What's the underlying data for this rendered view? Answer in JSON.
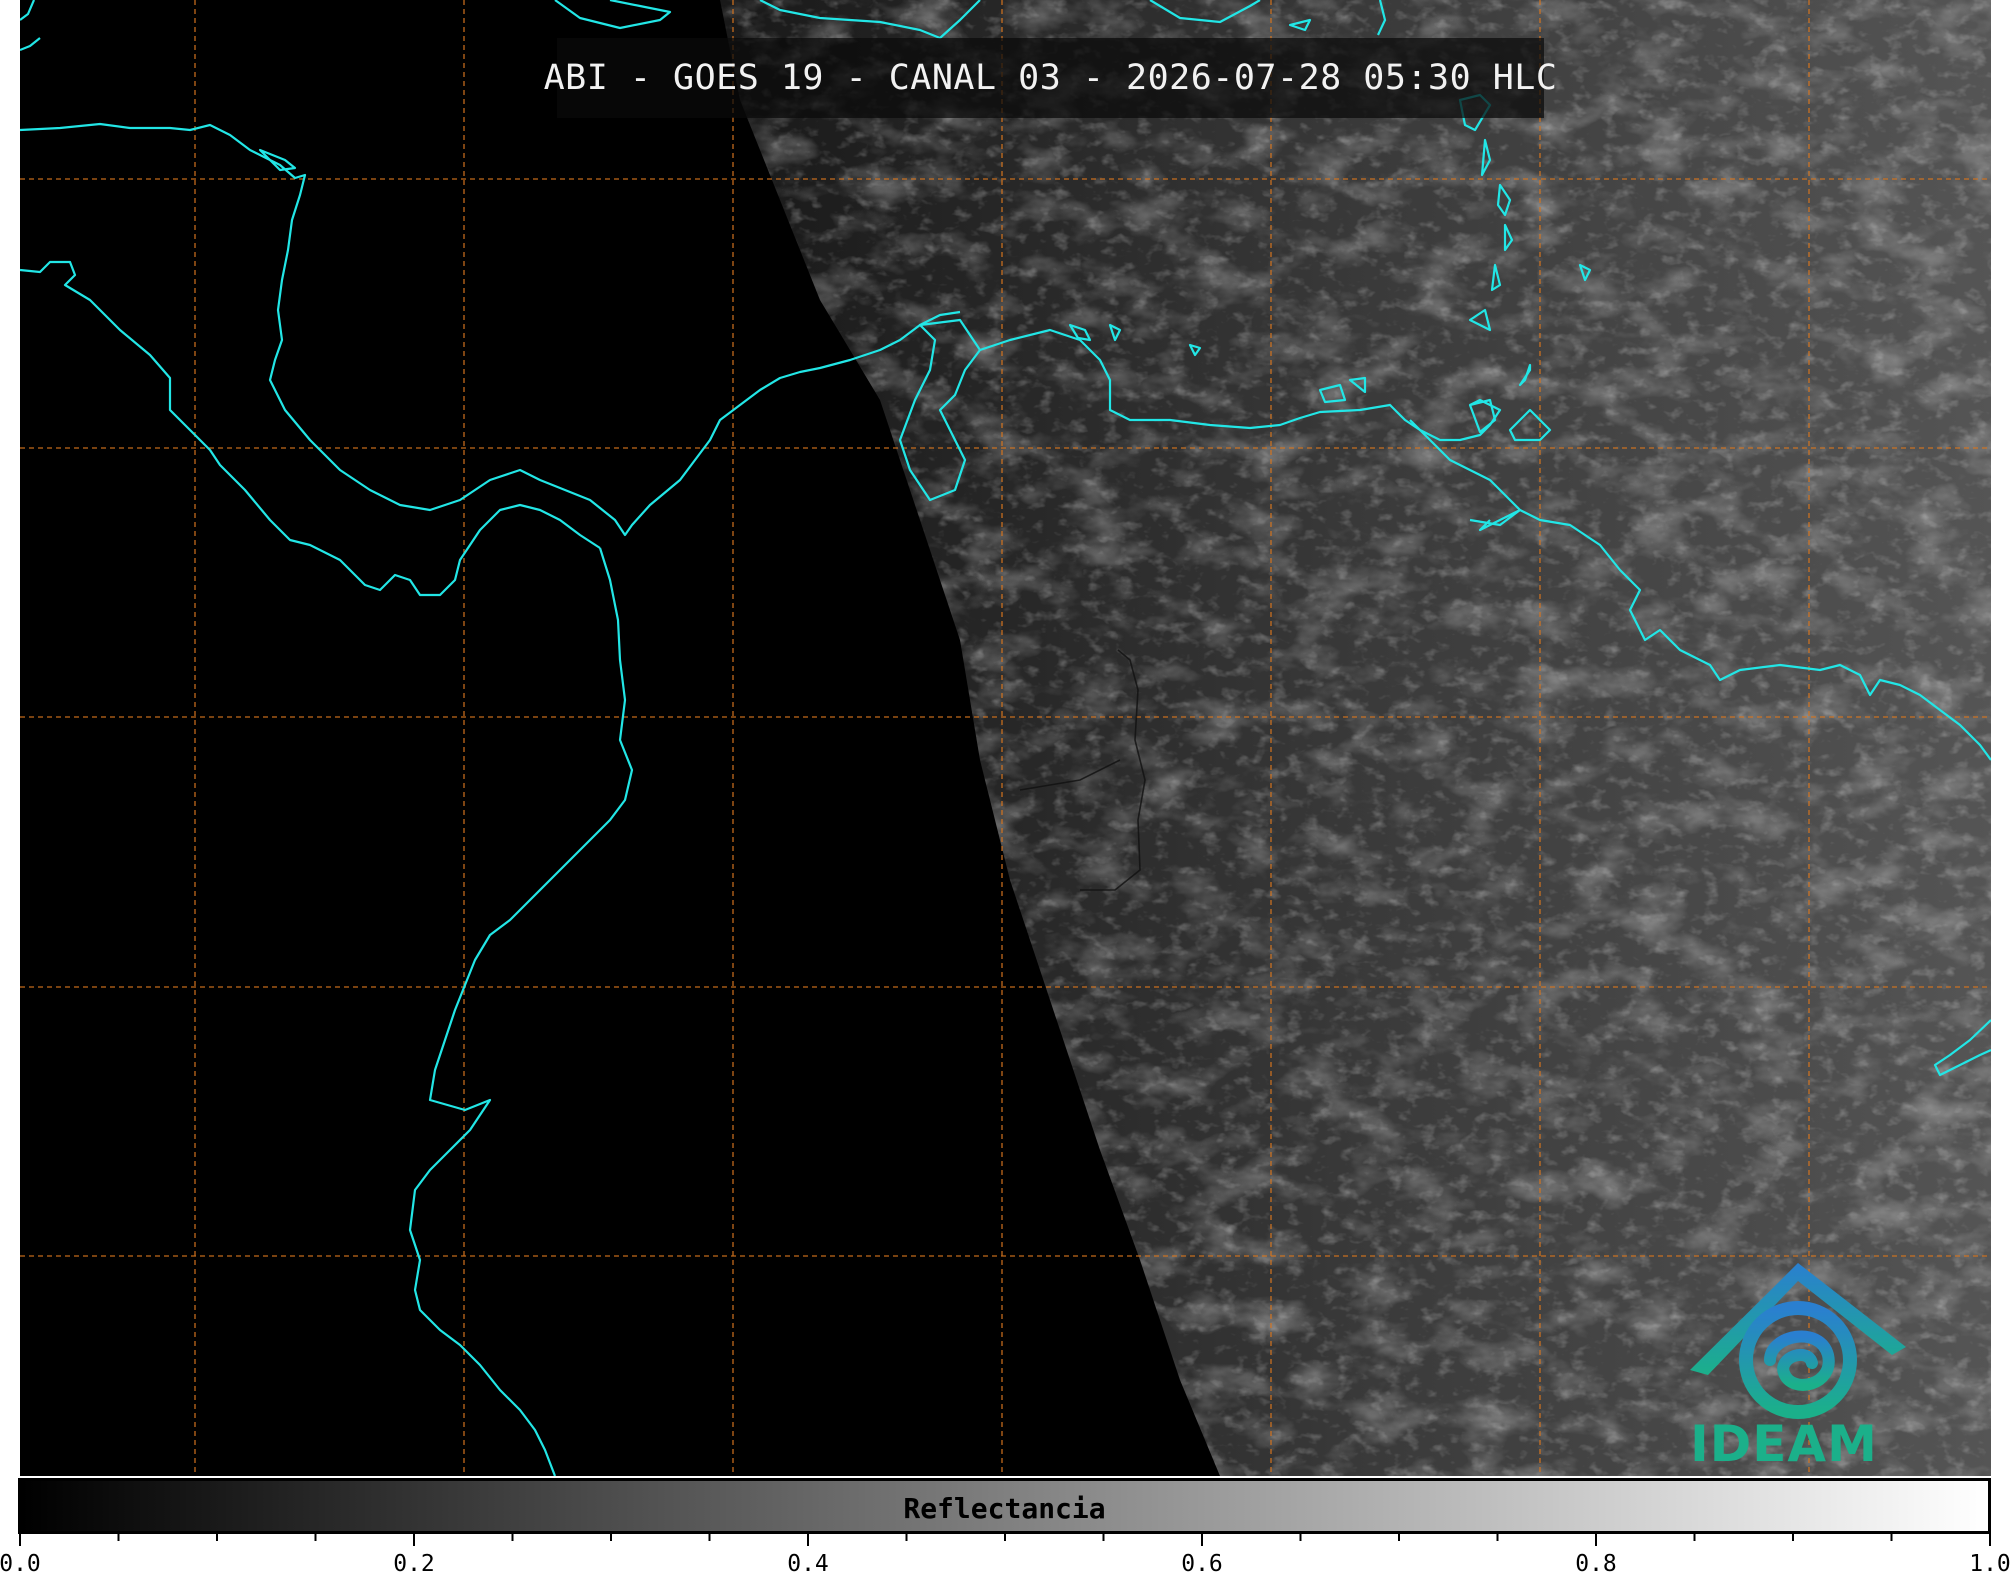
{
  "map": {
    "title": "ABI - GOES 19 - CANAL 03 - 2026-07-28 05:30 HLC",
    "coastline_color": "#22e6e6",
    "grid_color": "#d8761e",
    "border_color": "#1a1a1a",
    "background_color": "#000000",
    "terminator": "night on west side, illuminated clouds on east side"
  },
  "logo": {
    "name": "IDEAM",
    "colors": [
      "#2a7fd0",
      "#1bb08a"
    ]
  },
  "colorbar": {
    "label": "Reflectancia",
    "min": 0.0,
    "max": 1.0,
    "gradient_colors": [
      "#000000",
      "#ffffff"
    ],
    "tick_labels": [
      "0.0",
      "0.2",
      "0.4",
      "0.6",
      "0.8",
      "1.0"
    ]
  }
}
